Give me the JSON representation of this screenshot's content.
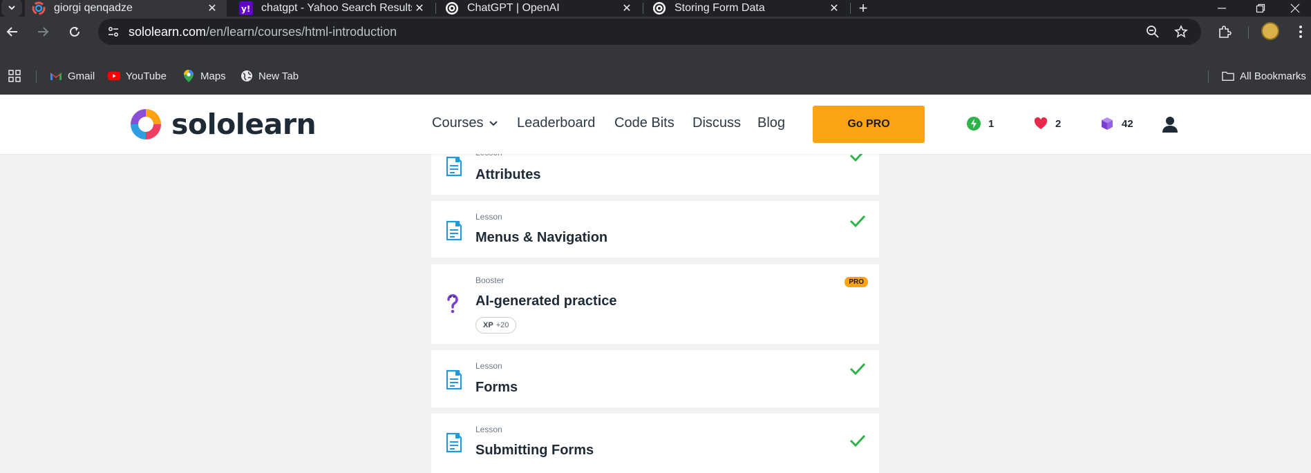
{
  "browser": {
    "tabs": [
      {
        "title": "giorgi qenqadze",
        "icon": "sololearn-favicon",
        "active": true
      },
      {
        "title": "chatgpt - Yahoo Search Results",
        "icon": "yahoo-favicon",
        "active": false
      },
      {
        "title": "ChatGPT | OpenAI",
        "icon": "openai-favicon",
        "active": false
      },
      {
        "title": "Storing Form Data",
        "icon": "openai-favicon",
        "active": false
      }
    ],
    "url_host": "sololearn.com",
    "url_path": "/en/learn/courses/html-introduction",
    "bookmarks": [
      {
        "label": "Gmail",
        "icon": "gmail-icon"
      },
      {
        "label": "YouTube",
        "icon": "youtube-icon"
      },
      {
        "label": "Maps",
        "icon": "maps-icon"
      },
      {
        "label": "New Tab",
        "icon": "globe-icon"
      }
    ],
    "all_bookmarks_label": "All Bookmarks"
  },
  "site": {
    "logo_text": "sololearn",
    "nav": {
      "courses": "Courses",
      "leaderboard": "Leaderboard",
      "code_bits": "Code Bits",
      "discuss": "Discuss",
      "blog": "Blog"
    },
    "go_pro": "Go PRO",
    "stats": {
      "streak": "1",
      "hearts": "2",
      "gems": "42"
    },
    "colors": {
      "accent": "#fba312",
      "check": "#2db34a",
      "lesson_icon": "#1e9be0",
      "booster_icon": "#7a3fd1"
    }
  },
  "lessons": [
    {
      "kind": "Lesson",
      "name": "Attributes",
      "completed": true
    },
    {
      "kind": "Lesson",
      "name": "Menus & Navigation",
      "completed": true
    },
    {
      "kind": "Booster",
      "name": "AI-generated practice",
      "badge": "PRO",
      "xp_label": "XP",
      "xp_value": "+20"
    },
    {
      "kind": "Lesson",
      "name": "Forms",
      "completed": true
    },
    {
      "kind": "Lesson",
      "name": "Submitting Forms",
      "completed": true
    }
  ]
}
